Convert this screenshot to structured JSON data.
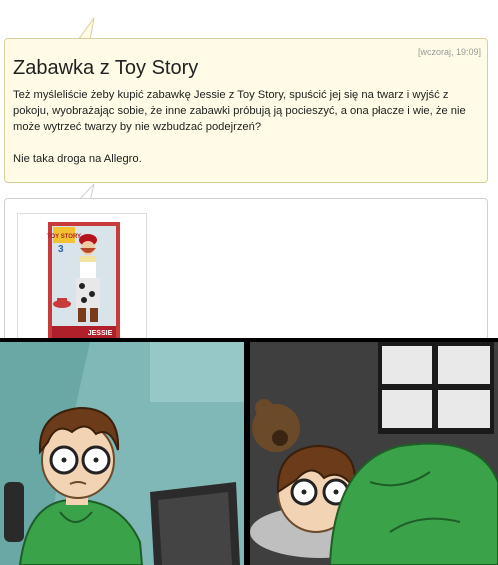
{
  "post": {
    "timestamp": "[wczoraj, 19:09]",
    "title": "Zabawka z Toy Story",
    "paragraph1": "Też myśleliście żeby kupić zabawkę Jessie z Toy Story, spuścić jej się na twarz i wyjść z pokoju, wyobrażając sobie, że inne zabawki próbują ją pocieszyć, a ona płacze i wie, że nie może wytrzeć twarzy by nie wzbudzać podejrzeń?",
    "paragraph2": "Nie taka droga na Allegro."
  },
  "product_image": {
    "box_label": "JESSIE",
    "logo_text": "TOY STORY",
    "logo_number": "3"
  },
  "colors": {
    "bubble_bg": "#fffbe6",
    "bubble_border": "#d9cf9a",
    "comic_panel_left_bg": "#7fb8b6",
    "comic_panel_right_bg": "#4a4a4a",
    "hoodie_green": "#3aa34a"
  }
}
